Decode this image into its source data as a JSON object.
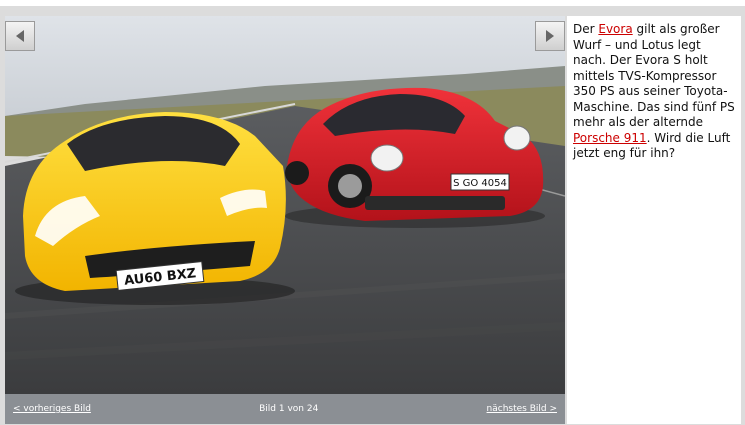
{
  "gallery": {
    "prev_link": "< vorheriges Bild",
    "next_link": "nächstes Bild >",
    "counter": "Bild 1 von 24"
  },
  "caption": {
    "t1": "Der ",
    "link1": "Evora",
    "t2": " gilt als großer Wurf – und Lotus legt nach. Der Evora S holt mittels TVS-Kompressor 350 PS aus seiner Toyota-Maschine. Das sind fünf PS mehr als der alternde ",
    "link2": "Porsche 911",
    "t3": ". Wird die Luft jetzt eng für ihn?"
  },
  "photo": {
    "plate_left": "AU60 BXZ",
    "plate_right": "S GO 4054"
  },
  "colors": {
    "link": "#cc0000",
    "bar": "#8b8f94",
    "frame": "#dcdcdc"
  }
}
